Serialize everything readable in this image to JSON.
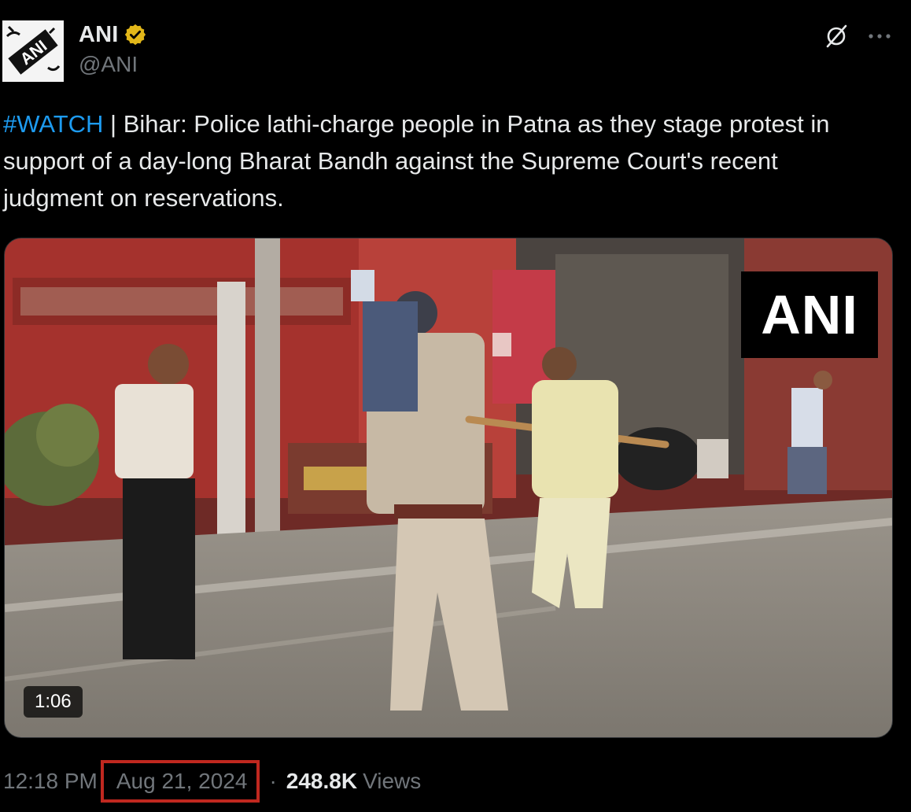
{
  "author": {
    "name": "ANI",
    "handle": "@ANI",
    "avatar_text": "ANI",
    "verified": true,
    "verified_color": "#e2b719"
  },
  "tweet": {
    "hashtag": "#WATCH",
    "text": " | Bihar: Police lathi-charge people in Patna as they stage protest in support of a day-long Bharat Bandh against the Supreme Court's recent judgment on reservations.",
    "hashtag_color": "#1d9bf0"
  },
  "media": {
    "watermark": "ANI",
    "duration": "1:06"
  },
  "meta": {
    "time": "12:18 PM",
    "separator": "·",
    "date": "Aug 21, 2024",
    "views_count": "248.8K",
    "views_label": "Views",
    "highlight_color": "#c0281f"
  },
  "icons": {
    "grok": "grok-icon",
    "more": "more-icon",
    "verified": "verified-badge-icon"
  }
}
